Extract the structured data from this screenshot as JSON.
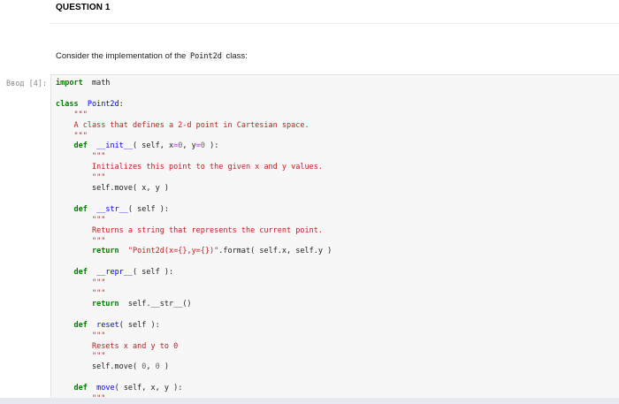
{
  "question": {
    "title": "QUESTION 1"
  },
  "prompt": {
    "before": "Consider the implementation of the ",
    "code": "Point2d",
    "after": " class:"
  },
  "cell": {
    "in_label": "Ввод [4]:",
    "lines": [
      [
        [
          "kw",
          "import"
        ],
        [
          "",
          "  math"
        ]
      ],
      [],
      [
        [
          "kw",
          "class"
        ],
        [
          "",
          "  "
        ],
        [
          "cls",
          "Point2d"
        ],
        [
          "",
          ":"
        ]
      ],
      [
        [
          "",
          "    "
        ],
        [
          "str",
          "\"\"\""
        ]
      ],
      [
        [
          "",
          "    "
        ],
        [
          "str",
          "A class that defines a 2-d point in Cartesian space."
        ]
      ],
      [
        [
          "",
          "    "
        ],
        [
          "str",
          "\"\"\""
        ]
      ],
      [
        [
          "",
          "    "
        ],
        [
          "kw",
          "def"
        ],
        [
          "",
          "  "
        ],
        [
          "fn",
          "__init__"
        ],
        [
          "",
          "( self, x"
        ],
        [
          "op",
          "="
        ],
        [
          "num",
          "0"
        ],
        [
          "",
          ", y"
        ],
        [
          "op",
          "="
        ],
        [
          "num",
          "0"
        ],
        [
          "",
          " ):"
        ]
      ],
      [
        [
          "",
          "        "
        ],
        [
          "str",
          "\"\"\""
        ]
      ],
      [
        [
          "",
          "        "
        ],
        [
          "str",
          "Initializes this point to the given x and y values."
        ]
      ],
      [
        [
          "",
          "        "
        ],
        [
          "str",
          "\"\"\""
        ]
      ],
      [
        [
          "",
          "        "
        ],
        [
          "",
          "self.move( x, y )"
        ]
      ],
      [],
      [
        [
          "",
          "    "
        ],
        [
          "kw",
          "def"
        ],
        [
          "",
          "  "
        ],
        [
          "fn",
          "__str__"
        ],
        [
          "",
          "( self ):"
        ]
      ],
      [
        [
          "",
          "        "
        ],
        [
          "str",
          "\"\"\""
        ]
      ],
      [
        [
          "",
          "        "
        ],
        [
          "str",
          "Returns a string that represents the current point."
        ]
      ],
      [
        [
          "",
          "        "
        ],
        [
          "str",
          "\"\"\""
        ]
      ],
      [
        [
          "",
          "        "
        ],
        [
          "kw",
          "return"
        ],
        [
          "",
          "  "
        ],
        [
          "str",
          "\"Point2d(x={},y={})\""
        ],
        [
          "",
          ".format( self.x, self.y )"
        ]
      ],
      [],
      [
        [
          "",
          "    "
        ],
        [
          "kw",
          "def"
        ],
        [
          "",
          "  "
        ],
        [
          "fn",
          "__repr__"
        ],
        [
          "",
          "( self ):"
        ]
      ],
      [
        [
          "",
          "        "
        ],
        [
          "str",
          "\"\"\""
        ]
      ],
      [
        [
          "",
          "        "
        ],
        [
          "str",
          "\"\"\""
        ]
      ],
      [
        [
          "",
          "        "
        ],
        [
          "kw",
          "return"
        ],
        [
          "",
          "  self.__str__()"
        ]
      ],
      [],
      [
        [
          "",
          "    "
        ],
        [
          "kw",
          "def"
        ],
        [
          "",
          "  "
        ],
        [
          "fn",
          "reset"
        ],
        [
          "",
          "( self ):"
        ]
      ],
      [
        [
          "",
          "        "
        ],
        [
          "str",
          "\"\"\""
        ]
      ],
      [
        [
          "",
          "        "
        ],
        [
          "str",
          "Resets x and y to 0"
        ]
      ],
      [
        [
          "",
          "        "
        ],
        [
          "str",
          "\"\"\""
        ]
      ],
      [
        [
          "",
          "        "
        ],
        [
          "",
          "self.move( "
        ],
        [
          "num",
          "0"
        ],
        [
          "",
          ", "
        ],
        [
          "num",
          "0"
        ],
        [
          "",
          " )"
        ]
      ],
      [],
      [
        [
          "",
          "    "
        ],
        [
          "kw",
          "def"
        ],
        [
          "",
          "  "
        ],
        [
          "fn",
          "move"
        ],
        [
          "",
          "( self, x, y ):"
        ]
      ],
      [
        [
          "",
          "        "
        ],
        [
          "str",
          "\"\"\""
        ]
      ]
    ]
  }
}
